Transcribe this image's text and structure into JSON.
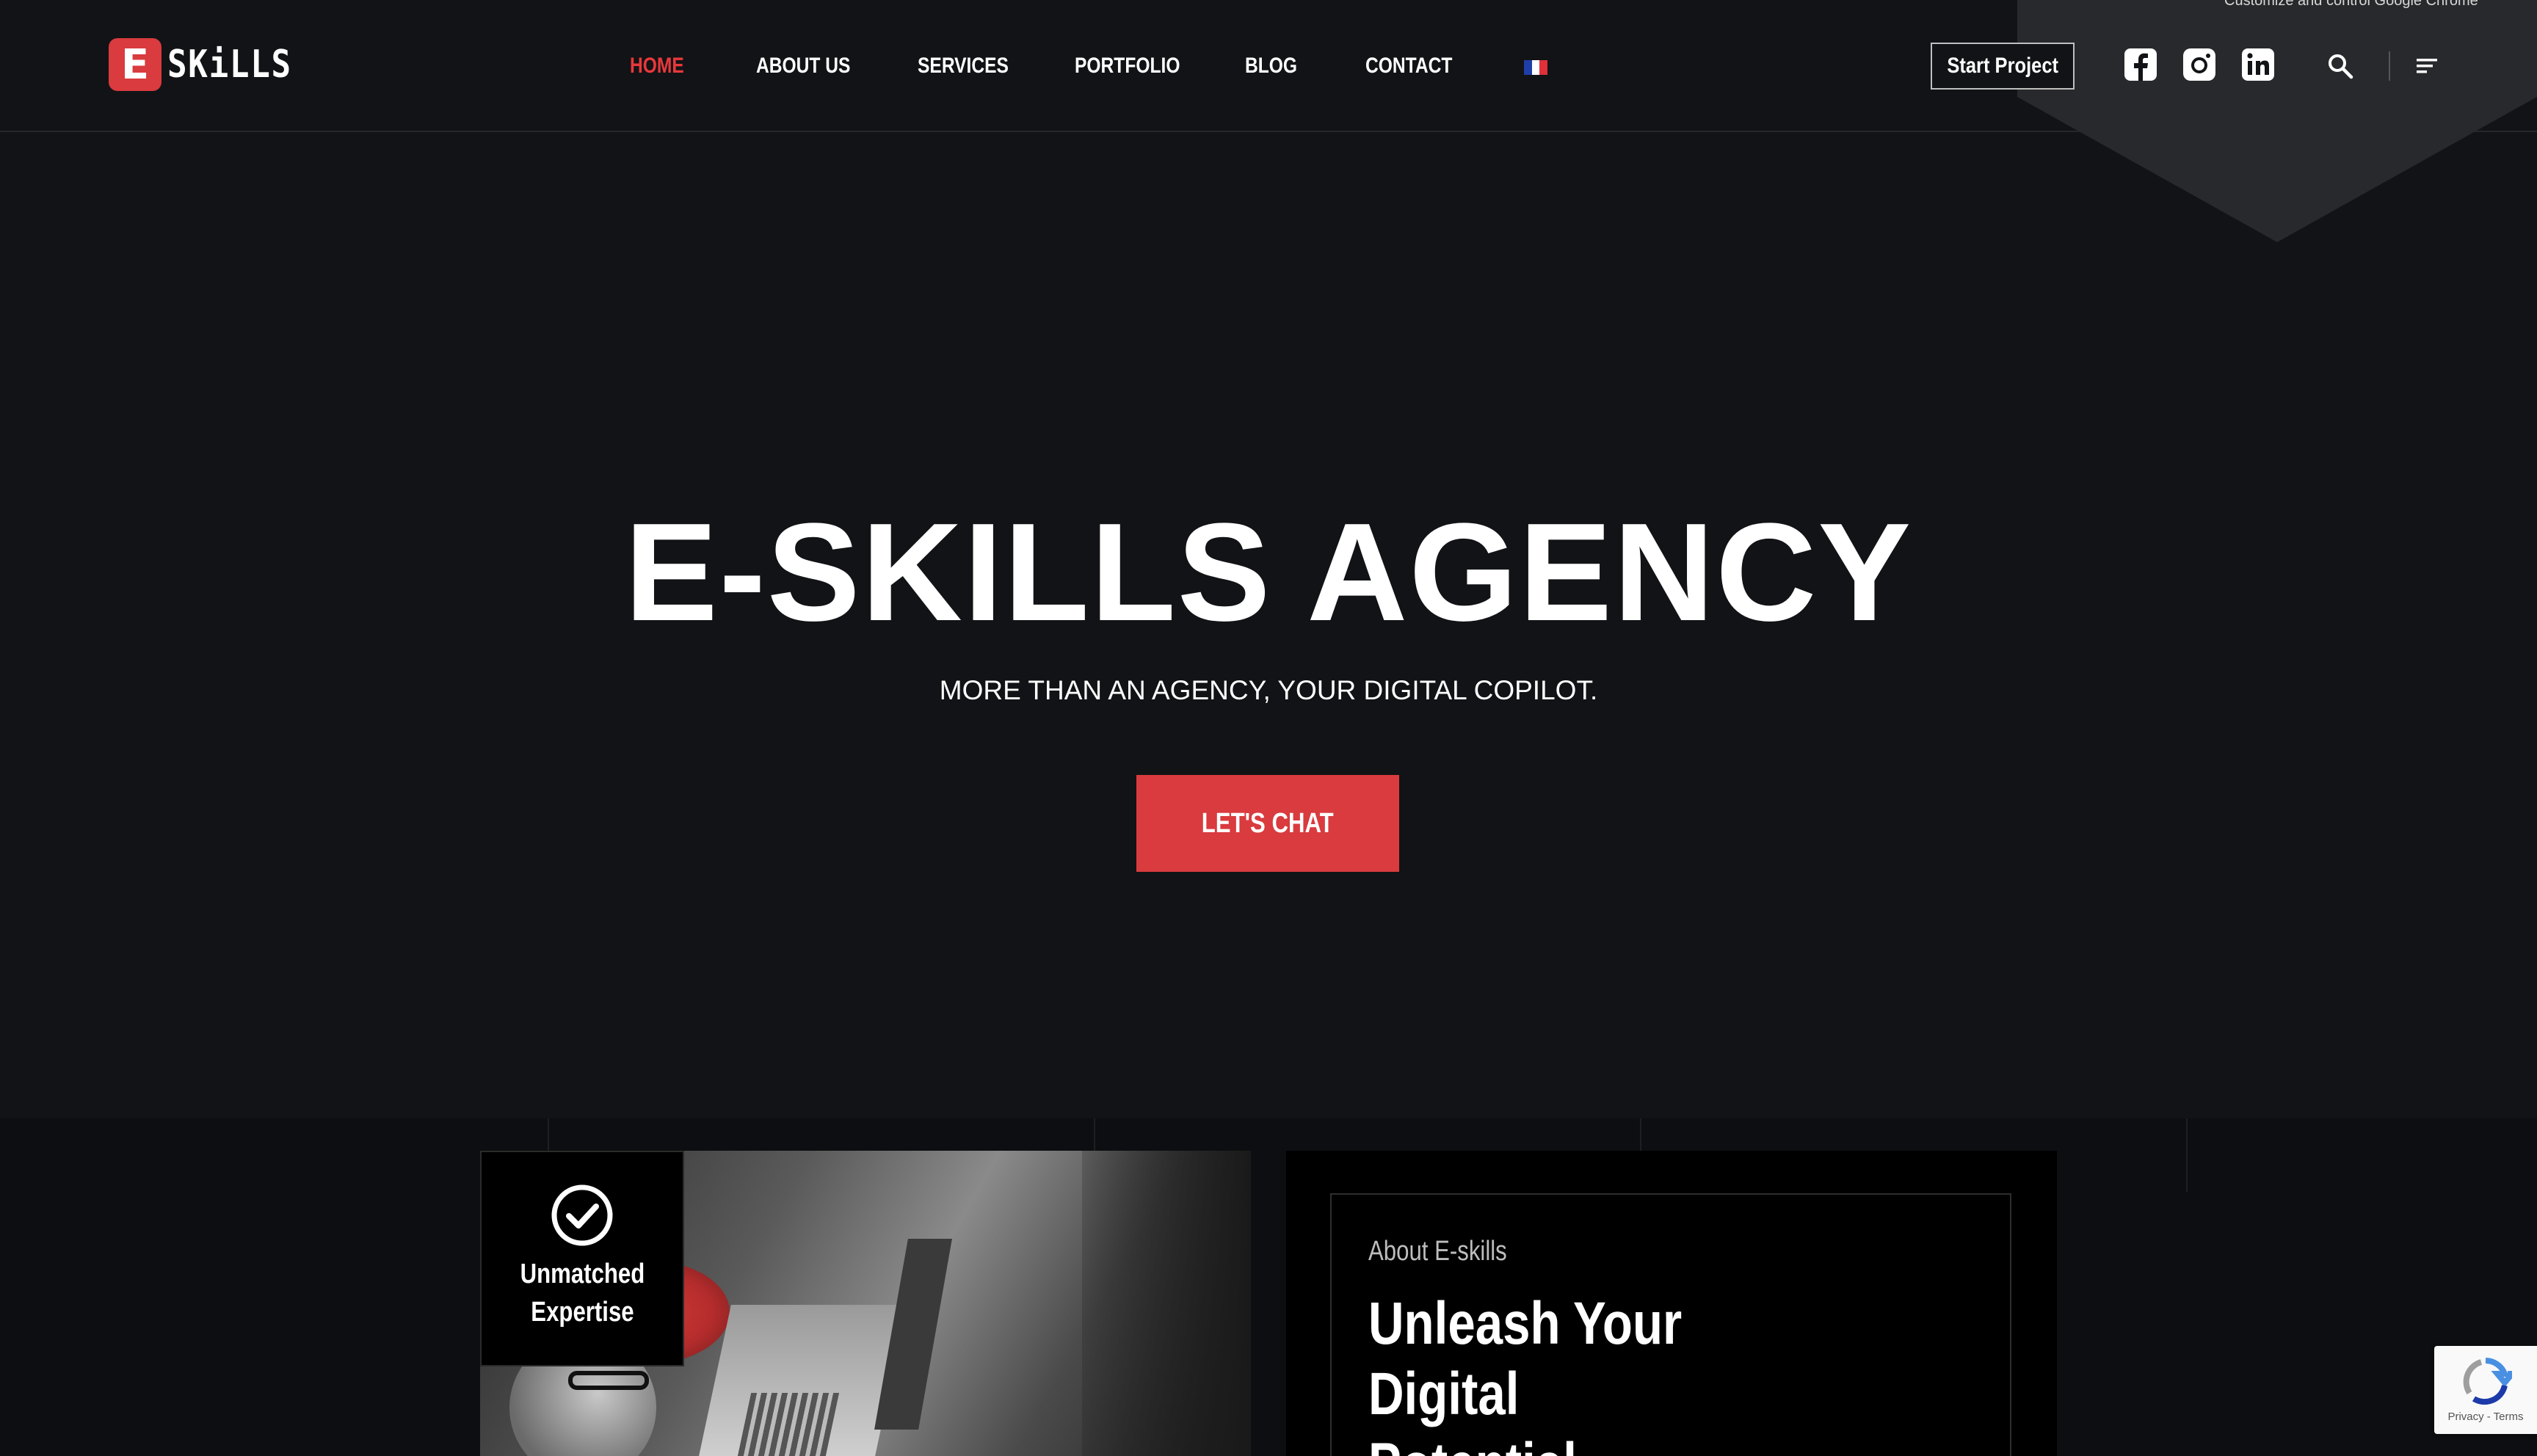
{
  "browser_tooltip": "Customize and control Google Chrome",
  "brand": {
    "logo_letter": "E",
    "logo_text": "SKiLLS"
  },
  "nav": {
    "items": [
      {
        "label": "HOME",
        "active": true
      },
      {
        "label": "ABOUT US",
        "active": false
      },
      {
        "label": "SERVICES",
        "active": false
      },
      {
        "label": "PORTFOLIO",
        "active": false
      },
      {
        "label": "BLOG",
        "active": false
      },
      {
        "label": "CONTACT",
        "active": false
      }
    ],
    "language_icon": "french-flag-icon"
  },
  "header_actions": {
    "start_project_label": "Start Project",
    "social_icons": [
      "facebook-icon",
      "instagram-icon",
      "linkedin-icon"
    ],
    "search_icon": "search-icon",
    "menu_icon": "menu-icon"
  },
  "hero": {
    "title": "E-SKILLS AGENCY",
    "subtitle": "MORE THAN AN AGENCY, YOUR DIGITAL COPILOT.",
    "cta_label": "LET'S CHAT"
  },
  "feature_badge": {
    "line1": "Unmatched",
    "line2": "Expertise",
    "icon": "checkmark-circle-icon"
  },
  "about": {
    "kicker": "About E-skills",
    "title_line1": "Unleash Your Digital",
    "title_line2": "Potential"
  },
  "recaptcha": {
    "footer": "Privacy - Terms"
  },
  "colors": {
    "background": "#121316",
    "accent": "#d93b3e",
    "active_nav": "#e8383b",
    "text": "#ffffff"
  }
}
